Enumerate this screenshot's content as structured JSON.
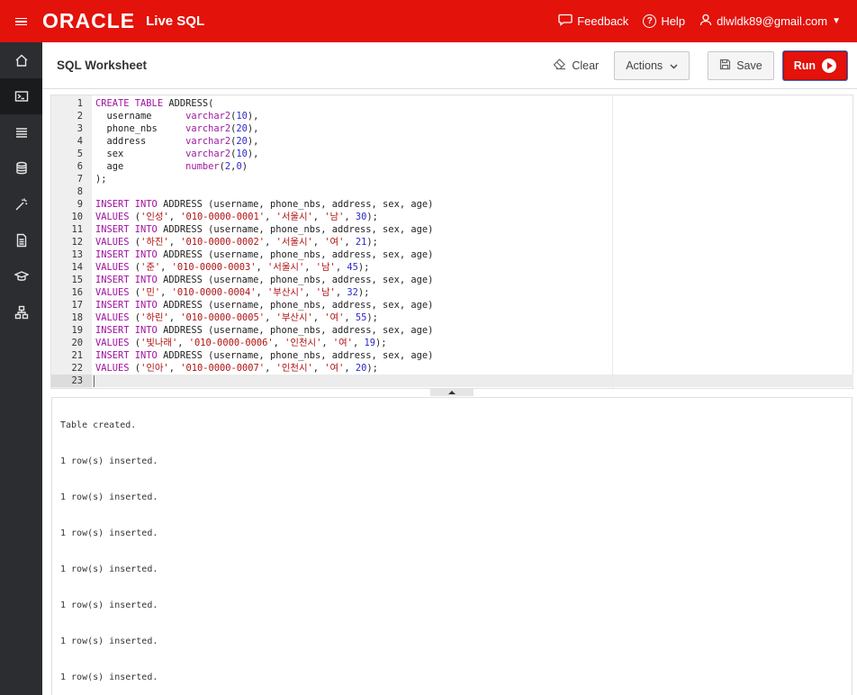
{
  "topbar": {
    "logo": "ORACLE",
    "product": "Live SQL",
    "feedback": "Feedback",
    "help": "Help",
    "user": "dlwldk89@gmail.com"
  },
  "sidebar": {
    "items": [
      "home",
      "sql-worksheet",
      "my-session",
      "schema",
      "quick-sql",
      "my-scripts",
      "my-tutorials",
      "code-library"
    ]
  },
  "header": {
    "title": "SQL Worksheet",
    "clear": "Clear",
    "actions": "Actions",
    "save": "Save",
    "run": "Run"
  },
  "editor": {
    "lines": [
      [
        [
          "kw",
          "CREATE TABLE"
        ],
        [
          "tx",
          " ADDRESS("
        ]
      ],
      [
        [
          "tx",
          "  username      "
        ],
        [
          "ty",
          "varchar2"
        ],
        [
          "tx",
          "("
        ],
        [
          "nm",
          "10"
        ],
        [
          "tx",
          "),"
        ]
      ],
      [
        [
          "tx",
          "  phone_nbs     "
        ],
        [
          "ty",
          "varchar2"
        ],
        [
          "tx",
          "("
        ],
        [
          "nm",
          "20"
        ],
        [
          "tx",
          "),"
        ]
      ],
      [
        [
          "tx",
          "  address       "
        ],
        [
          "ty",
          "varchar2"
        ],
        [
          "tx",
          "("
        ],
        [
          "nm",
          "20"
        ],
        [
          "tx",
          "),"
        ]
      ],
      [
        [
          "tx",
          "  sex           "
        ],
        [
          "ty",
          "varchar2"
        ],
        [
          "tx",
          "("
        ],
        [
          "nm",
          "10"
        ],
        [
          "tx",
          "),"
        ]
      ],
      [
        [
          "tx",
          "  age           "
        ],
        [
          "ty",
          "number"
        ],
        [
          "tx",
          "("
        ],
        [
          "nm",
          "2"
        ],
        [
          "tx",
          ","
        ],
        [
          "nm",
          "0"
        ],
        [
          "tx",
          ")"
        ]
      ],
      [
        [
          "tx",
          ");"
        ]
      ],
      [
        [
          "tx",
          ""
        ]
      ],
      [
        [
          "kw",
          "INSERT INTO"
        ],
        [
          "tx",
          " ADDRESS (username, phone_nbs, address, sex, age)"
        ]
      ],
      [
        [
          "kw",
          "VALUES"
        ],
        [
          "tx",
          " ("
        ],
        [
          "st",
          "'인성'"
        ],
        [
          "tx",
          ", "
        ],
        [
          "st",
          "'010-0000-0001'"
        ],
        [
          "tx",
          ", "
        ],
        [
          "st",
          "'서울시'"
        ],
        [
          "tx",
          ", "
        ],
        [
          "st",
          "'남'"
        ],
        [
          "tx",
          ", "
        ],
        [
          "nm",
          "30"
        ],
        [
          "tx",
          ");"
        ]
      ],
      [
        [
          "kw",
          "INSERT INTO"
        ],
        [
          "tx",
          " ADDRESS (username, phone_nbs, address, sex, age)"
        ]
      ],
      [
        [
          "kw",
          "VALUES"
        ],
        [
          "tx",
          " ("
        ],
        [
          "st",
          "'하진'"
        ],
        [
          "tx",
          ", "
        ],
        [
          "st",
          "'010-0000-0002'"
        ],
        [
          "tx",
          ", "
        ],
        [
          "st",
          "'서울시'"
        ],
        [
          "tx",
          ", "
        ],
        [
          "st",
          "'여'"
        ],
        [
          "tx",
          ", "
        ],
        [
          "nm",
          "21"
        ],
        [
          "tx",
          ");"
        ]
      ],
      [
        [
          "kw",
          "INSERT INTO"
        ],
        [
          "tx",
          " ADDRESS (username, phone_nbs, address, sex, age)"
        ]
      ],
      [
        [
          "kw",
          "VALUES"
        ],
        [
          "tx",
          " ("
        ],
        [
          "st",
          "'준'"
        ],
        [
          "tx",
          ", "
        ],
        [
          "st",
          "'010-0000-0003'"
        ],
        [
          "tx",
          ", "
        ],
        [
          "st",
          "'서울시'"
        ],
        [
          "tx",
          ", "
        ],
        [
          "st",
          "'남'"
        ],
        [
          "tx",
          ", "
        ],
        [
          "nm",
          "45"
        ],
        [
          "tx",
          ");"
        ]
      ],
      [
        [
          "kw",
          "INSERT INTO"
        ],
        [
          "tx",
          " ADDRESS (username, phone_nbs, address, sex, age)"
        ]
      ],
      [
        [
          "kw",
          "VALUES"
        ],
        [
          "tx",
          " ("
        ],
        [
          "st",
          "'민'"
        ],
        [
          "tx",
          ", "
        ],
        [
          "st",
          "'010-0000-0004'"
        ],
        [
          "tx",
          ", "
        ],
        [
          "st",
          "'부산시'"
        ],
        [
          "tx",
          ", "
        ],
        [
          "st",
          "'남'"
        ],
        [
          "tx",
          ", "
        ],
        [
          "nm",
          "32"
        ],
        [
          "tx",
          ");"
        ]
      ],
      [
        [
          "kw",
          "INSERT INTO"
        ],
        [
          "tx",
          " ADDRESS (username, phone_nbs, address, sex, age)"
        ]
      ],
      [
        [
          "kw",
          "VALUES"
        ],
        [
          "tx",
          " ("
        ],
        [
          "st",
          "'하린'"
        ],
        [
          "tx",
          ", "
        ],
        [
          "st",
          "'010-0000-0005'"
        ],
        [
          "tx",
          ", "
        ],
        [
          "st",
          "'부산시'"
        ],
        [
          "tx",
          ", "
        ],
        [
          "st",
          "'여'"
        ],
        [
          "tx",
          ", "
        ],
        [
          "nm",
          "55"
        ],
        [
          "tx",
          ");"
        ]
      ],
      [
        [
          "kw",
          "INSERT INTO"
        ],
        [
          "tx",
          " ADDRESS (username, phone_nbs, address, sex, age)"
        ]
      ],
      [
        [
          "kw",
          "VALUES"
        ],
        [
          "tx",
          " ("
        ],
        [
          "st",
          "'빛나래'"
        ],
        [
          "tx",
          ", "
        ],
        [
          "st",
          "'010-0000-0006'"
        ],
        [
          "tx",
          ", "
        ],
        [
          "st",
          "'인천시'"
        ],
        [
          "tx",
          ", "
        ],
        [
          "st",
          "'여'"
        ],
        [
          "tx",
          ", "
        ],
        [
          "nm",
          "19"
        ],
        [
          "tx",
          ");"
        ]
      ],
      [
        [
          "kw",
          "INSERT INTO"
        ],
        [
          "tx",
          " ADDRESS (username, phone_nbs, address, sex, age)"
        ]
      ],
      [
        [
          "kw",
          "VALUES"
        ],
        [
          "tx",
          " ("
        ],
        [
          "st",
          "'인아'"
        ],
        [
          "tx",
          ", "
        ],
        [
          "st",
          "'010-0000-0007'"
        ],
        [
          "tx",
          ", "
        ],
        [
          "st",
          "'인천시'"
        ],
        [
          "tx",
          ", "
        ],
        [
          "st",
          "'여'"
        ],
        [
          "tx",
          ", "
        ],
        [
          "nm",
          "20"
        ],
        [
          "tx",
          ");"
        ]
      ],
      [
        [
          "tx",
          ""
        ]
      ]
    ],
    "active_line": 23
  },
  "output": {
    "lines": [
      "Table created.",
      "1 row(s) inserted.",
      "1 row(s) inserted.",
      "1 row(s) inserted.",
      "1 row(s) inserted.",
      "1 row(s) inserted.",
      "1 row(s) inserted.",
      "1 row(s) inserted."
    ]
  },
  "colors": {
    "brand_red": "#e3120b",
    "sidebar_bg": "#2b2d30"
  }
}
